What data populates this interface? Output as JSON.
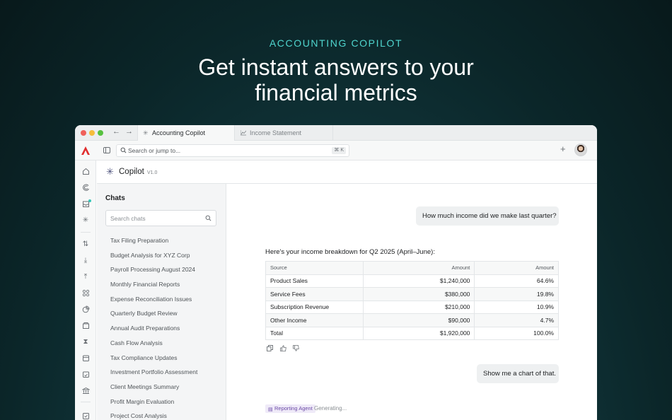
{
  "hero": {
    "eyebrow": "ACCOUNTING COPILOT",
    "title_line1": "Get instant answers to your",
    "title_line2": "financial metrics"
  },
  "tabs": [
    {
      "label": "Accounting Copilot",
      "icon": "sparkle-icon",
      "active": true
    },
    {
      "label": "Income Statement",
      "icon": "chart-line-icon",
      "active": false
    }
  ],
  "toolbar": {
    "search_placeholder": "Search or jump to...",
    "search_shortcut": "⌘ K"
  },
  "copilot": {
    "title": "Copilot",
    "version": "V1.0"
  },
  "chats": {
    "title": "Chats",
    "search_placeholder": "Search chats",
    "items": [
      "Tax Filing Preparation",
      "Budget Analysis for XYZ Corp",
      "Payroll Processing August 2024",
      "Monthly Financial Reports",
      "Expense Reconciliation Issues",
      "Quarterly Budget Review",
      "Annual Audit Preparations",
      "Cash Flow Analysis",
      "Tax Compliance Updates",
      "Investment Portfolio Assessment",
      "Client Meetings Summary",
      "Profit Margin Evaluation",
      "Project Cost Analysis"
    ]
  },
  "conversation": {
    "user_message_1": "How much income did we make last quarter?",
    "answer_intro": "Here's your income breakdown for Q2 2025 (April–June):",
    "table": {
      "headers": [
        "Source",
        "Amount",
        "Amount"
      ],
      "rows": [
        [
          "Product Sales",
          "$1,240,000",
          "64.6%"
        ],
        [
          "Service Fees",
          "$380,000",
          "19.8%"
        ],
        [
          "Subscription Revenue",
          "$210,000",
          "10.9%"
        ],
        [
          "Other Income",
          "$90,000",
          "4.7%"
        ],
        [
          "Total",
          "$1,920,000",
          "100.0%"
        ]
      ]
    },
    "user_message_2": "Show me a chart of that.",
    "agent_label": "Reporting Agent",
    "status": "Generating..."
  },
  "colors": {
    "accent_teal": "#4fd6cf",
    "logo_red": "#e02d2d",
    "agent_purple": "#6b4aa6"
  }
}
